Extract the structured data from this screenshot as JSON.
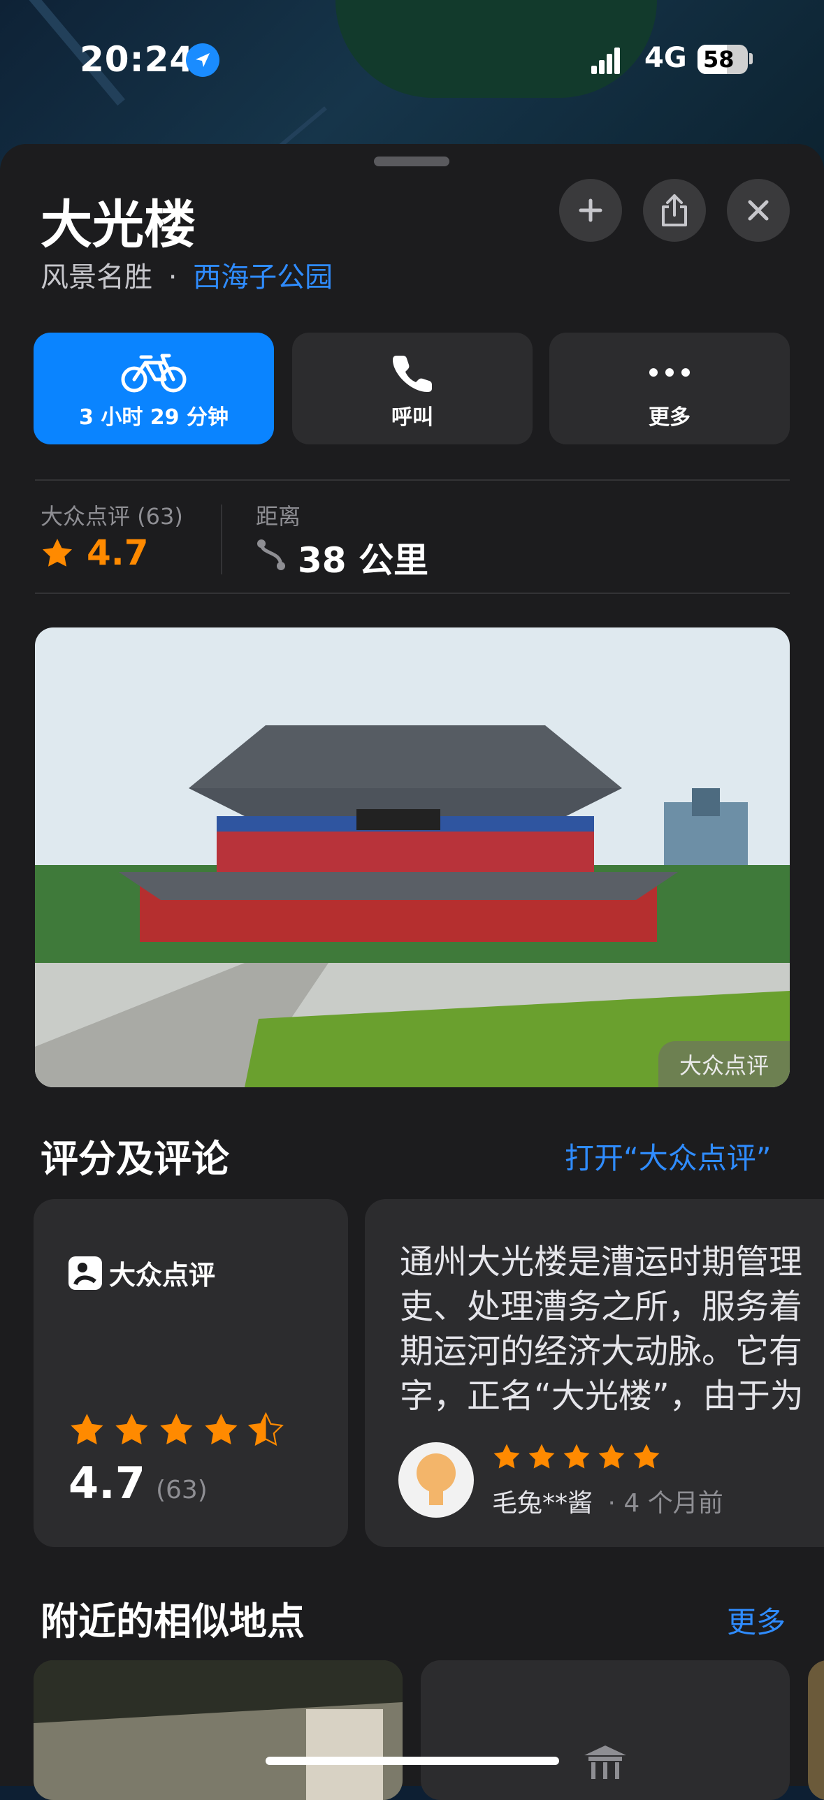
{
  "status_bar": {
    "time": "20:24",
    "network": "4G",
    "battery": "58"
  },
  "place": {
    "name": "大光楼",
    "category": "风景名胜",
    "separator": "·",
    "area_link": "西海子公园"
  },
  "actions": [
    {
      "label": "3 小时 29 分钟",
      "icon": "bicycle-icon"
    },
    {
      "label": "呼叫",
      "icon": "phone-icon"
    },
    {
      "label": "更多",
      "icon": "more-icon"
    }
  ],
  "stats": {
    "rating_label": "大众点评 (63)",
    "rating_value": "4.7",
    "distance_label": "距离",
    "distance_value": "38 公里"
  },
  "photo": {
    "badge": "大众点评"
  },
  "reviews": {
    "heading": "评分及评论",
    "open_link": "打开“大众点评”",
    "brand": "大众点评",
    "score": "4.7",
    "count": "(63)",
    "stars": 4.5,
    "review_lines": [
      "通州大光楼是漕运时期管理",
      "吏、处理漕务之所，服务着",
      "期运河的经济大动脉。它有",
      "字，正名“大光楼”，由于为"
    ],
    "review_stars": 5,
    "reviewer": "毛兔**酱",
    "review_time": "· 4 个月前"
  },
  "nearby": {
    "heading": "附近的相似地点",
    "more": "更多"
  },
  "colors": {
    "accent": "#0a84ff",
    "link": "#2f8cff",
    "star": "#ff8a00",
    "sheet": "#1c1c1e",
    "card": "#2c2c2e"
  }
}
